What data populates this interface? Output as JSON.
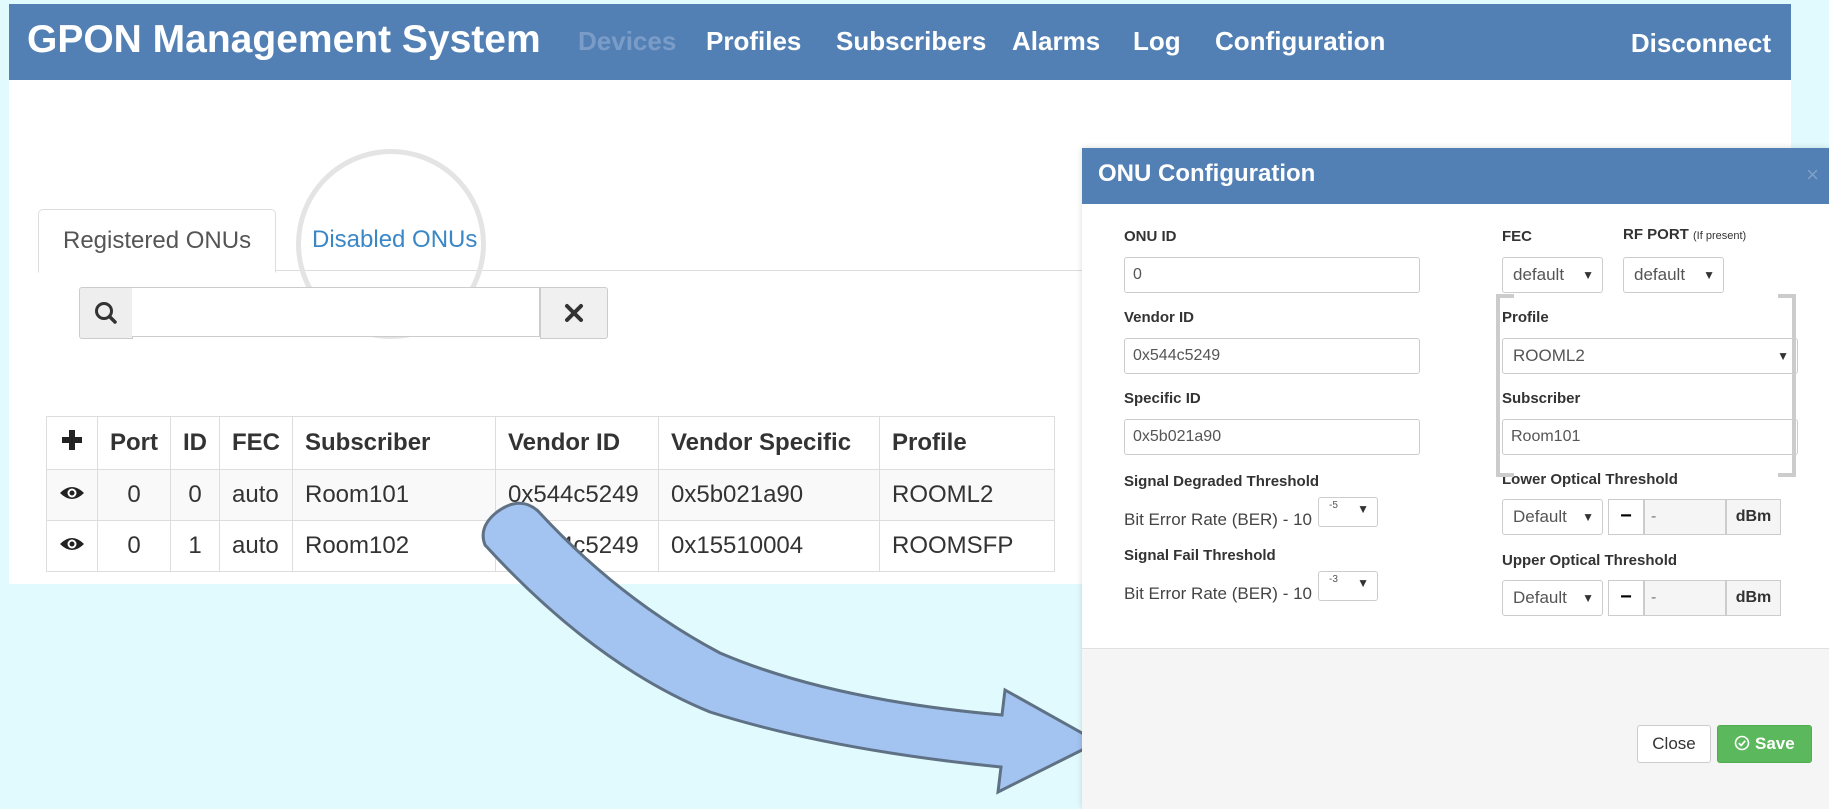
{
  "navbar": {
    "brand": "GPON Management System",
    "items": [
      "Devices",
      "Profiles",
      "Subscribers",
      "Alarms",
      "Log",
      "Configuration"
    ],
    "disconnect": "Disconnect"
  },
  "tabs": {
    "registered": "Registered ONUs",
    "disabled": "Disabled ONUs"
  },
  "search": {
    "value": "",
    "placeholder": ""
  },
  "table": {
    "add_symbol": "+",
    "headers": [
      "Port",
      "ID",
      "FEC",
      "Subscriber",
      "Vendor ID",
      "Vendor Specific",
      "Profile"
    ],
    "rows": [
      [
        "0",
        "0",
        "auto",
        "Room101",
        "0x544c5249",
        "0x5b021a90",
        "ROOML2"
      ],
      [
        "0",
        "1",
        "auto",
        "Room102",
        "0x544c5249",
        "0x15510004",
        "ROOMSFP"
      ]
    ]
  },
  "modal": {
    "title": "ONU Configuration",
    "close_symbol": "×",
    "onu_id_label": "ONU ID",
    "onu_id_value": "0",
    "vendor_id_label": "Vendor ID",
    "vendor_id_value": "0x544c5249",
    "specific_id_label": "Specific ID",
    "specific_id_value": "0x5b021a90",
    "sd_label": "Signal Degraded Threshold",
    "sd_text": "Bit Error Rate (BER) - 10",
    "sd_exp": "-5",
    "sf_label": "Signal Fail Threshold",
    "sf_text": "Bit Error Rate (BER) - 10",
    "sf_exp": "-3",
    "fec_label": "FEC",
    "fec_value": "default",
    "rf_label": "RF PORT",
    "rf_hint": "(If present)",
    "rf_value": "default",
    "profile_label": "Profile",
    "profile_value": "ROOML2",
    "subscriber_label": "Subscriber",
    "subscriber_value": "Room101",
    "lower_label": "Lower Optical Threshold",
    "lower_mode": "Default",
    "lower_value": "-",
    "upper_label": "Upper Optical Threshold",
    "upper_mode": "Default",
    "upper_value": "-",
    "stepper_minus": "−",
    "unit": "dBm",
    "close_button": "Close",
    "save_button": "Save"
  }
}
